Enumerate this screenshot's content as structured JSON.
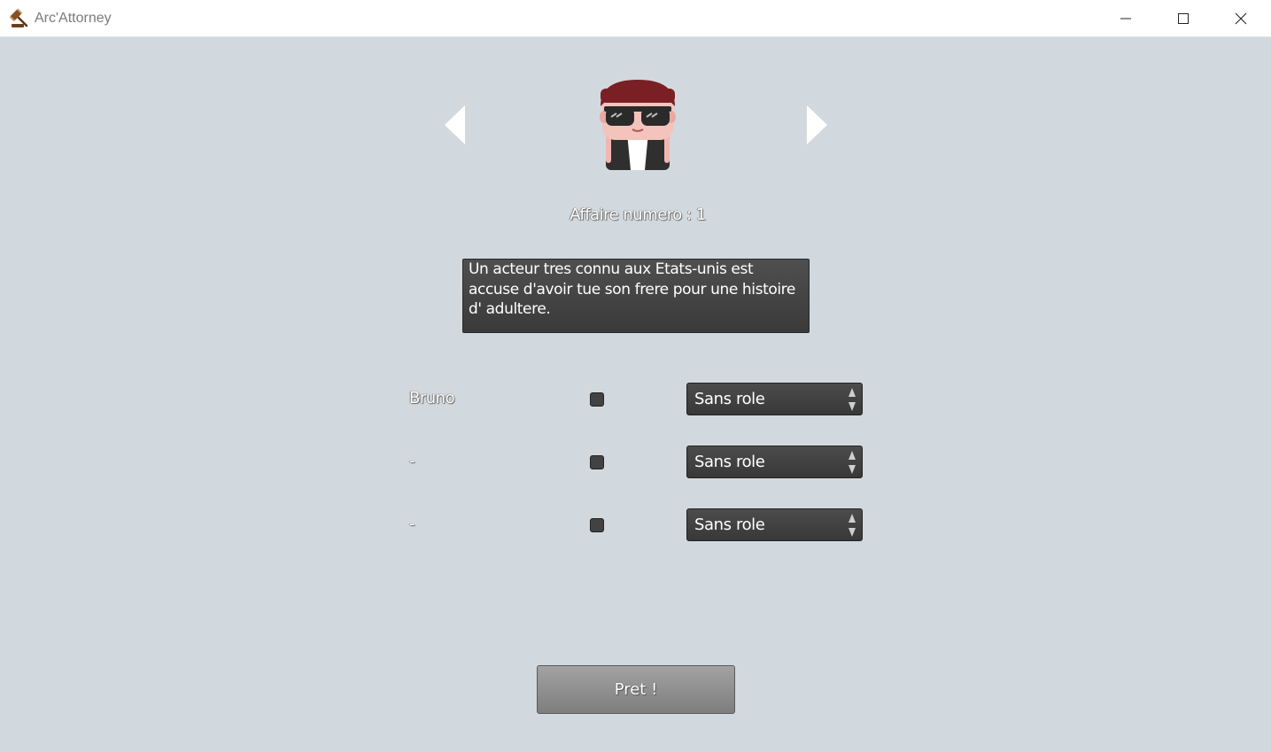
{
  "window": {
    "title": "Arc'Attorney",
    "icon": "gavel-icon",
    "controls": [
      "minimize-icon",
      "maximize-icon",
      "close-icon"
    ]
  },
  "case": {
    "label": "Affaire numero : 1",
    "description": "Un acteur tres connu aux Etats-unis est accuse d'avoir tue son frere pour une histoire d' adultere."
  },
  "character": {
    "icon": "character-avatar-sunglasses",
    "prev_icon": "arrow-left-icon",
    "next_icon": "arrow-right-icon"
  },
  "players": [
    {
      "name": "Bruno",
      "checked": false,
      "role": "Sans role"
    },
    {
      "name": "-",
      "checked": false,
      "role": "Sans role"
    },
    {
      "name": "-",
      "checked": false,
      "role": "Sans role"
    }
  ],
  "ready_button": {
    "label": "Pret !"
  },
  "colors": {
    "background": "#d2d9de",
    "panel": "#434343",
    "button": "#8f8f8f",
    "text": "#ffffff"
  }
}
